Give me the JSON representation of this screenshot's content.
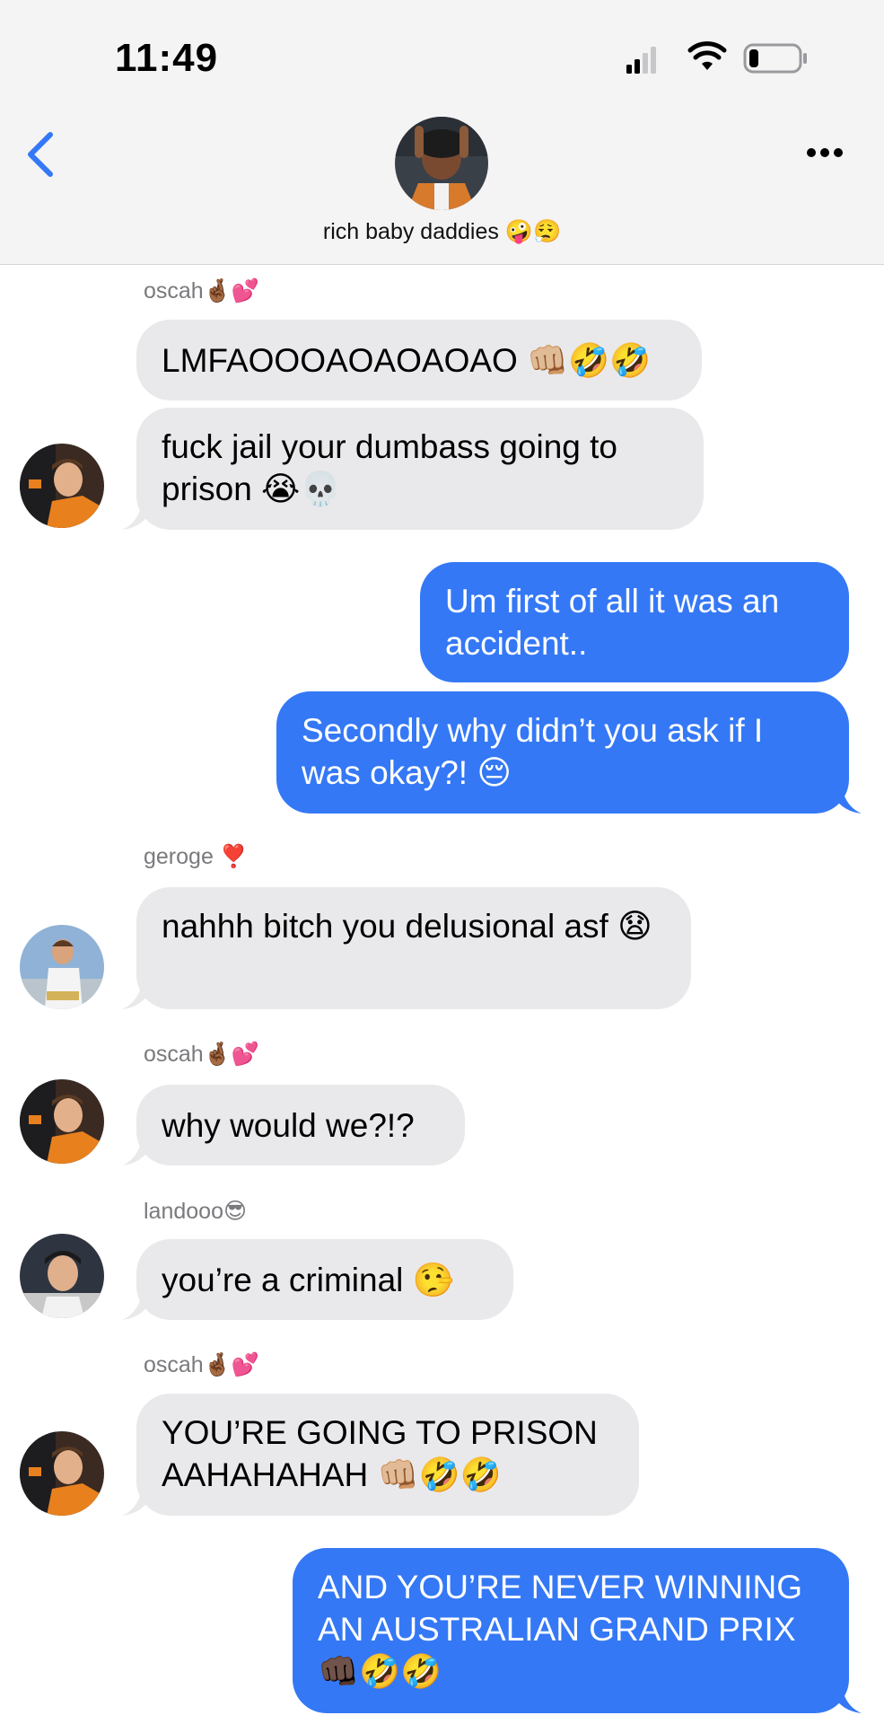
{
  "status_bar": {
    "time": "11:49"
  },
  "chat": {
    "name": "rich baby daddies 🤪😮‍💨"
  },
  "messages": [
    {
      "sender": "oscah🤞🏾💕",
      "text": "LMFAOOOAOAOAOAO 👊🏼🤣🤣"
    },
    {
      "text": "fuck jail your dumbass going to prison 😭💀"
    },
    {
      "text": "Um first of all it was an accident.."
    },
    {
      "text": "Secondly why didn’t you ask if I was okay?! 😔"
    },
    {
      "sender": "geroge ❣️",
      "text": "nahhh bitch you delusional asf 😧"
    },
    {
      "sender": "oscah🤞🏾💕",
      "text": "why would we?!?"
    },
    {
      "sender": "landooo😎",
      "text": "you’re a criminal 🤥"
    },
    {
      "sender": "oscah🤞🏾💕",
      "text": "YOU’RE GOING TO PRISON AAHAHAHAH 👊🏼🤣🤣"
    },
    {
      "text": "AND YOU’RE NEVER WINNING AN AUSTRALIAN GRAND PRIX 👊🏿🤣🤣"
    }
  ],
  "colors": {
    "outgoing": "#3478f6",
    "incoming": "#e9e9eb",
    "accent": "#3478f6"
  }
}
